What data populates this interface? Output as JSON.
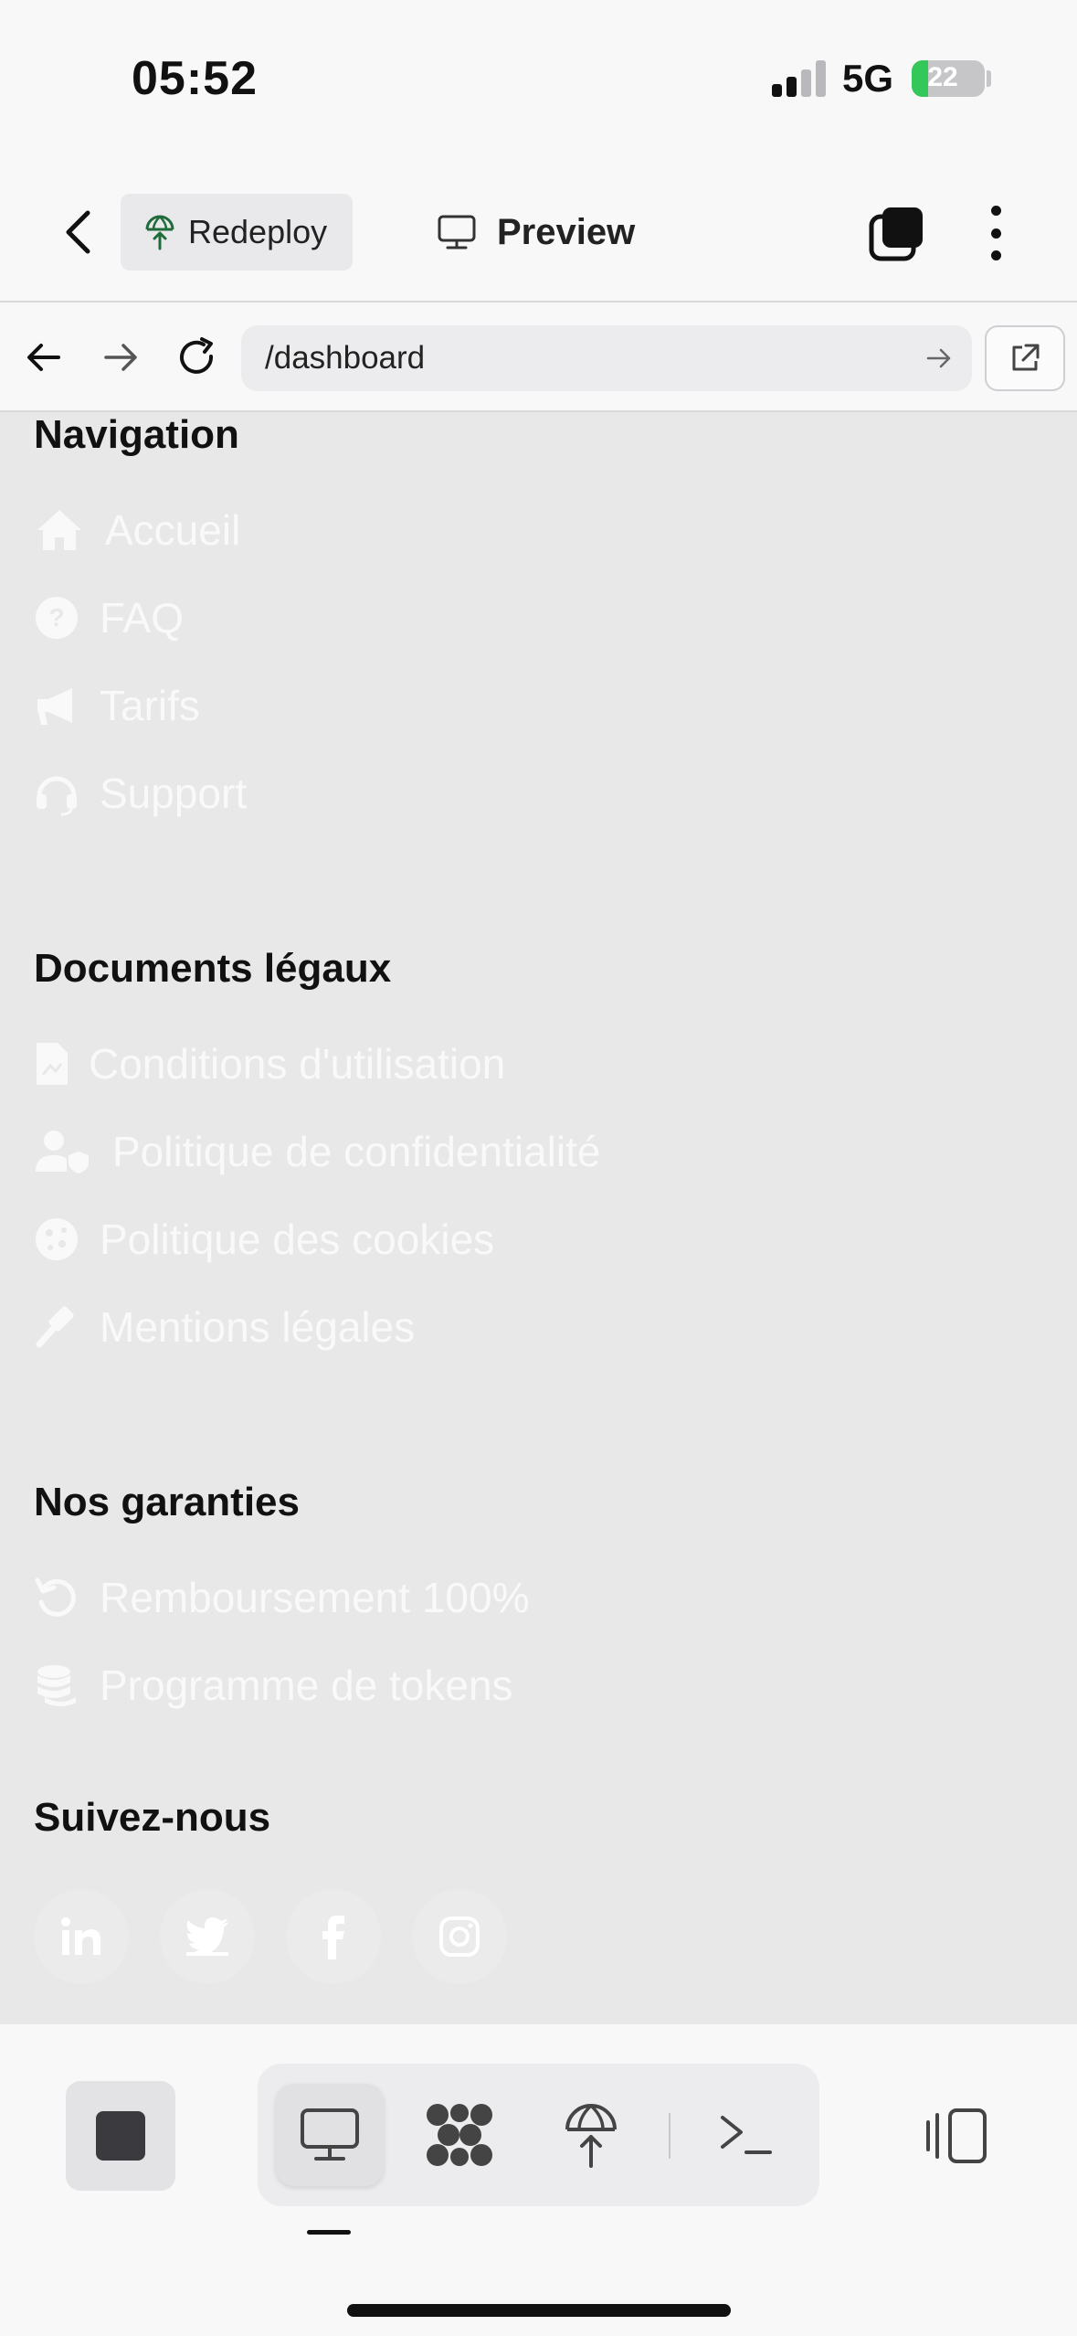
{
  "status": {
    "time": "05:52",
    "network": "5G",
    "battery": "22"
  },
  "toolbar": {
    "redeploy_label": "Redeploy",
    "preview_label": "Preview"
  },
  "address": {
    "url": "/dashboard"
  },
  "sections": {
    "navigation": {
      "title": "Navigation",
      "items": [
        "Accueil",
        "FAQ",
        "Tarifs",
        "Support"
      ]
    },
    "legal": {
      "title": "Documents légaux",
      "items": [
        "Conditions d'utilisation",
        "Politique de confidentialité",
        "Politique des cookies",
        "Mentions légales"
      ]
    },
    "guarantees": {
      "title": "Nos garanties",
      "items": [
        "Remboursement 100%",
        "Programme de tokens"
      ]
    },
    "social": {
      "title": "Suivez-nous",
      "icons": [
        "linkedin-icon",
        "twitter-icon",
        "facebook-icon",
        "instagram-icon"
      ]
    }
  },
  "colors": {
    "content_bg": "#e8e8e9",
    "muted_link": "#f9f9f9",
    "battery_green": "#34c759",
    "redeploy_icon": "#1f6b3a"
  }
}
